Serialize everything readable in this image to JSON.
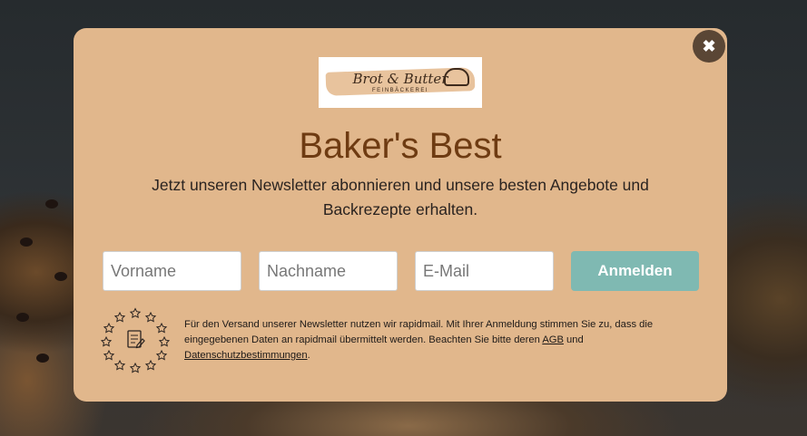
{
  "logo": {
    "brand": "Brot & Butter",
    "tagline": "FEINBÄCKEREI"
  },
  "popup": {
    "close_glyph": "✖",
    "title": "Baker's Best",
    "intro": "Jetzt unseren Newsletter abonnieren und unsere besten Angebote und Backrezepte erhalten."
  },
  "form": {
    "first_name_placeholder": "Vorname",
    "last_name_placeholder": "Nachname",
    "email_placeholder": "E-Mail",
    "submit_label": "Anmelden"
  },
  "consent": {
    "text_before": "Für den Versand unserer Newsletter nutzen wir rapidmail. Mit Ihrer Anmeldung stimmen Sie zu, dass die eingegebenen Daten an rapidmail übermittelt werden. Beachten Sie bitte deren ",
    "agb_link": "AGB",
    "text_middle": " und ",
    "privacy_link": "Datenschutzbestimmungen",
    "text_after": "."
  },
  "icons": {
    "close": "close-icon",
    "seal": "eu-gdpr-seal-icon"
  },
  "colors": {
    "popup_background": "#e1b78c",
    "title": "#6e3b12",
    "submit_button": "#7fb9b2",
    "close_button": "#5a4635"
  }
}
